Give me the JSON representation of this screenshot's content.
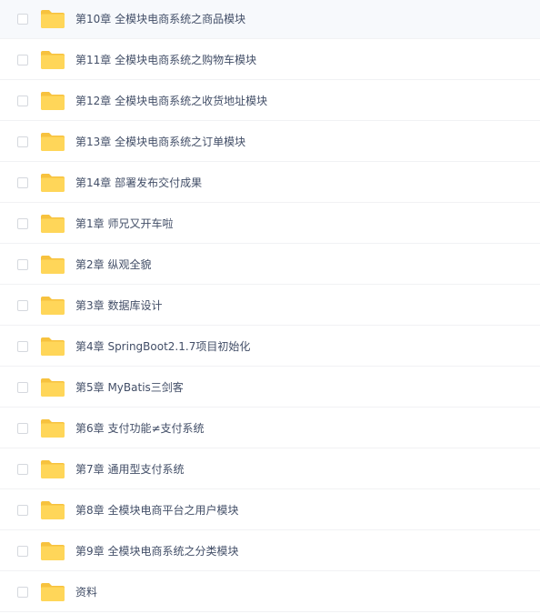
{
  "file_list": {
    "items": [
      {
        "name": "第10章 全模块电商系统之商品模块",
        "icon": "folder-icon",
        "checked": false
      },
      {
        "name": "第11章 全模块电商系统之购物车模块",
        "icon": "folder-icon",
        "checked": false
      },
      {
        "name": "第12章 全模块电商系统之收货地址模块",
        "icon": "folder-icon",
        "checked": false
      },
      {
        "name": "第13章 全模块电商系统之订单模块",
        "icon": "folder-icon",
        "checked": false
      },
      {
        "name": "第14章 部署发布交付成果",
        "icon": "folder-icon",
        "checked": false
      },
      {
        "name": "第1章 师兄又开车啦",
        "icon": "folder-icon",
        "checked": false
      },
      {
        "name": "第2章 纵观全貌",
        "icon": "folder-icon",
        "checked": false
      },
      {
        "name": "第3章 数据库设计",
        "icon": "folder-icon",
        "checked": false
      },
      {
        "name": "第4章 SpringBoot2.1.7项目初始化",
        "icon": "folder-icon",
        "checked": false
      },
      {
        "name": "第5章 MyBatis三剑客",
        "icon": "folder-icon",
        "checked": false
      },
      {
        "name": "第6章 支付功能≠支付系统",
        "icon": "folder-icon",
        "checked": false
      },
      {
        "name": "第7章 通用型支付系统",
        "icon": "folder-icon",
        "checked": false
      },
      {
        "name": "第8章 全模块电商平台之用户模块",
        "icon": "folder-icon",
        "checked": false
      },
      {
        "name": "第9章 全模块电商系统之分类模块",
        "icon": "folder-icon",
        "checked": false
      },
      {
        "name": "资料",
        "icon": "folder-icon",
        "checked": false
      }
    ]
  },
  "colors": {
    "folder_body": "#ffd659",
    "folder_back": "#f7c23e",
    "text": "#424e67",
    "divider": "#f1f2f4",
    "checkbox_border": "#d5d8de"
  }
}
